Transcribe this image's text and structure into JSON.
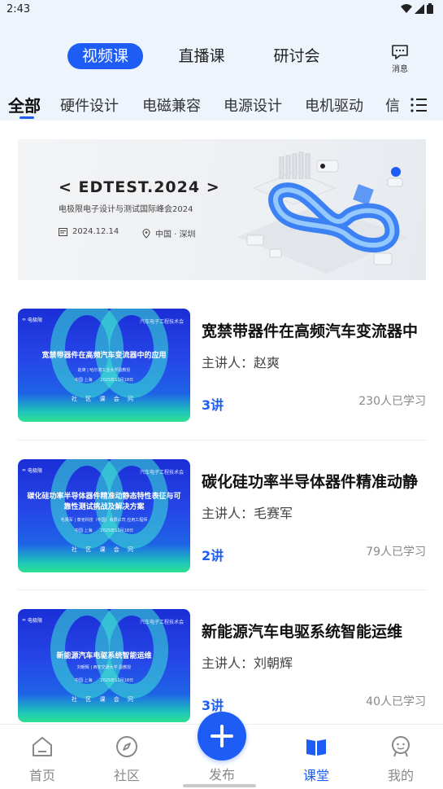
{
  "status_bar": {
    "time": "2:43"
  },
  "header": {
    "type_tabs": [
      {
        "label": "视频课",
        "active": true
      },
      {
        "label": "直播课",
        "active": false
      },
      {
        "label": "研讨会",
        "active": false
      }
    ],
    "message_label": "消息"
  },
  "categories": {
    "items": [
      "全部",
      "硬件设计",
      "电磁兼容",
      "电源设计",
      "电机驱动",
      "信"
    ],
    "active_index": 0
  },
  "banner": {
    "title": "< EDTEST.2024 >",
    "subtitle": "电极限电子设计与测试国际峰会2024",
    "date": "2024.12.14",
    "location": "中国 · 深圳"
  },
  "courses": [
    {
      "thumb_title": "宽禁带器件在高频汽车变流器中的应用",
      "thumb_speaker": "赵爽 | 哈尔滨工业大学副教授",
      "thumb_meta": "中国·上海　　2025年11月18日",
      "title": "宽禁带器件在高频汽车变流器中",
      "speaker": "主讲人：赵爽",
      "lessons": "3讲",
      "learners": "230人已学习"
    },
    {
      "thumb_title": "碳化硅功率半导体器件精准动静态特性表征与可靠性测试挑战及解决方案",
      "thumb_speaker": "毛赛军 | 泰克科技（中国）有限公司 应用工程师",
      "thumb_meta": "中国·上海　　2025年11月18日",
      "title": "碳化硅功率半导体器件精准动静",
      "speaker": "主讲人：毛赛军",
      "lessons": "2讲",
      "learners": "79人已学习"
    },
    {
      "thumb_title": "新能源汽车电驱系统智能运维",
      "thumb_speaker": "刘朝辉 | 西安交通大学 副教授",
      "thumb_meta": "中国·上海　　2025年11月18日",
      "title": "新能源汽车电驱系统智能运维",
      "speaker": "主讲人：刘朝辉",
      "lessons": "3讲",
      "learners": "40人已学习"
    }
  ],
  "thumb_logo": "电极限",
  "thumb_org": "汽车电子工程技术会",
  "thumb_bottom": "社 区 课 会 问",
  "bottom_nav": {
    "items": [
      {
        "label": "首页",
        "icon": "home-icon",
        "active": false
      },
      {
        "label": "社区",
        "icon": "compass-icon",
        "active": false
      },
      {
        "label": "发布",
        "icon": "plus-icon",
        "active": false
      },
      {
        "label": "课堂",
        "icon": "book-icon",
        "active": true
      },
      {
        "label": "我的",
        "icon": "profile-icon",
        "active": false
      }
    ]
  },
  "colors": {
    "accent": "#1d5cf5",
    "header_bg": "#edf4fc",
    "muted": "#888888"
  }
}
